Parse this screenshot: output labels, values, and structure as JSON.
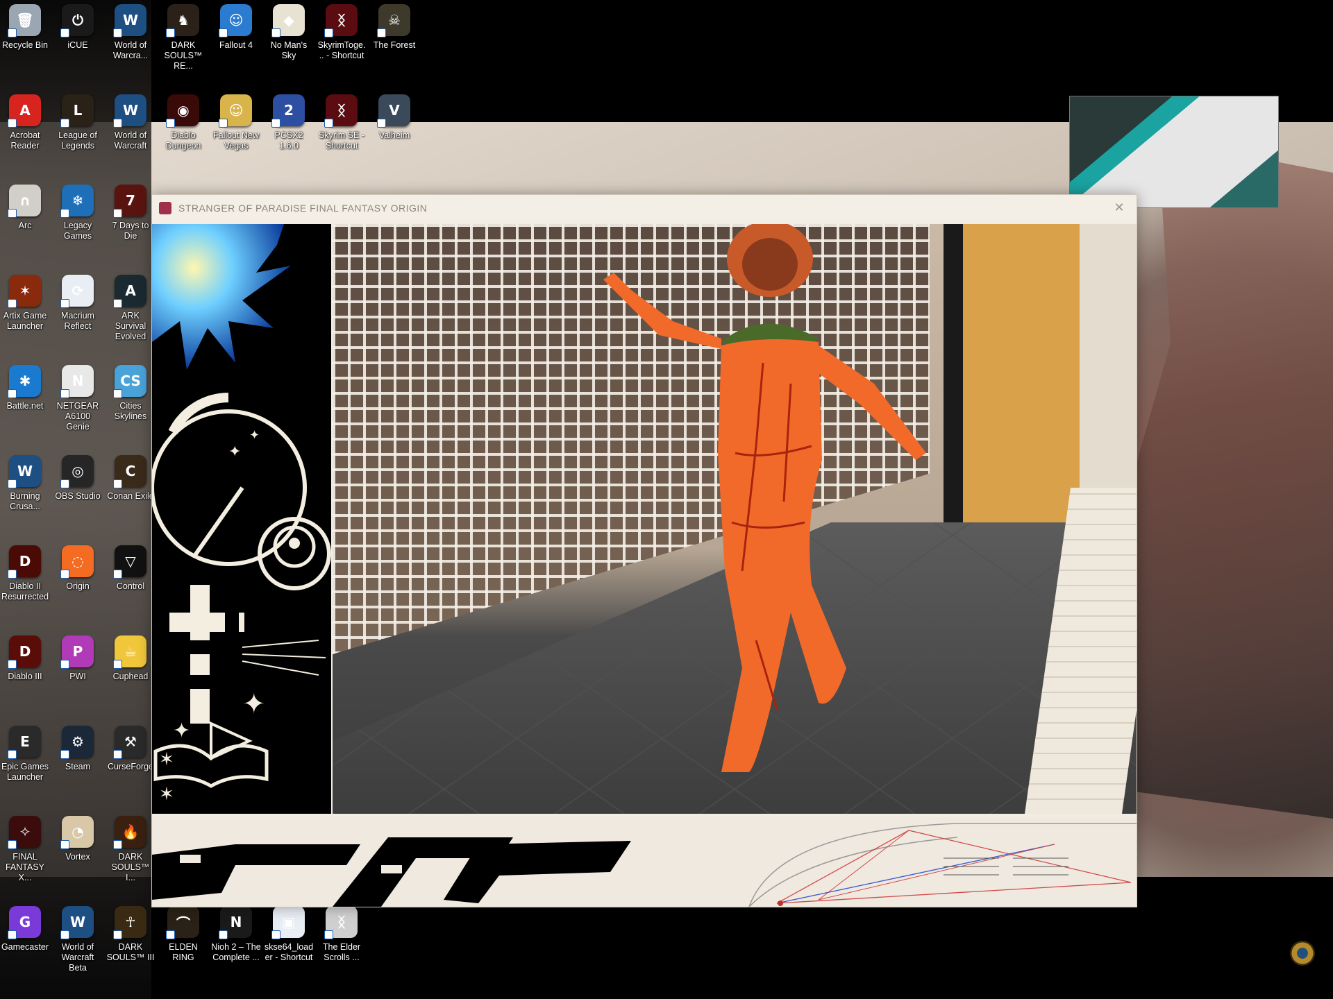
{
  "desktop_icons": [
    {
      "label": "Recycle Bin",
      "icon": "recycle-bin-icon",
      "color": "#9aa6b2",
      "glyph": "🗑"
    },
    {
      "label": "iCUE",
      "icon": "icue-icon",
      "color": "#1a1a1a",
      "glyph": "⏻"
    },
    {
      "label": "World of Warcra...",
      "icon": "world-of-warcraft-icon",
      "color": "#1d4f82",
      "glyph": "W"
    },
    {
      "label": "DARK SOULS™ RE...",
      "icon": "dark-souls-remastered-icon",
      "color": "#2b2118",
      "glyph": "♞"
    },
    {
      "label": "Fallout 4",
      "icon": "fallout-4-icon",
      "color": "#2b7bd0",
      "glyph": "☺"
    },
    {
      "label": "No Man's Sky",
      "icon": "no-mans-sky-icon",
      "color": "#e8e2d2",
      "glyph": "◆"
    },
    {
      "label": "SkyrimToge... - Shortcut",
      "icon": "skyrim-together-icon",
      "color": "#5a0c10",
      "glyph": "ᛝ"
    },
    {
      "label": "The Forest",
      "icon": "the-forest-icon",
      "color": "#3d3a2c",
      "glyph": "☠"
    },
    {
      "label": "Acrobat Reader",
      "icon": "acrobat-reader-icon",
      "color": "#d8241f",
      "glyph": "A"
    },
    {
      "label": "League of Legends",
      "icon": "league-of-legends-icon",
      "color": "#2a2216",
      "glyph": "L"
    },
    {
      "label": "World of Warcraft",
      "icon": "world-of-warcraft-icon-2",
      "color": "#1d4f82",
      "glyph": "W"
    },
    {
      "label": "Diablo Dungeon",
      "icon": "diablo-icon",
      "color": "#3a0a08",
      "glyph": "◉"
    },
    {
      "label": "Fallout New Vegas",
      "icon": "fallout-new-vegas-icon",
      "color": "#d9b44a",
      "glyph": "☺"
    },
    {
      "label": "PCSX2 1.6.0",
      "icon": "pcsx2-icon",
      "color": "#2d4fa3",
      "glyph": "2"
    },
    {
      "label": "Skyrim SE - Shortcut",
      "icon": "skyrim-se-icon",
      "color": "#5a0c10",
      "glyph": "ᛝ"
    },
    {
      "label": "Valheim",
      "icon": "valheim-icon",
      "color": "#3a4a5a",
      "glyph": "V"
    },
    {
      "label": "Arc",
      "icon": "arc-icon",
      "color": "#d2cfc8",
      "glyph": "∩"
    },
    {
      "label": "Legacy Games",
      "icon": "legacy-games-icon",
      "color": "#1f6fb8",
      "glyph": "❄"
    },
    {
      "label": "7 Days to Die",
      "icon": "7-days-to-die-icon",
      "color": "#5a1410",
      "glyph": "7"
    },
    {
      "label": "Artix Game Launcher",
      "icon": "artix-icon",
      "color": "#8a2a0c",
      "glyph": "✶"
    },
    {
      "label": "Macrium Reflect",
      "icon": "macrium-reflect-icon",
      "color": "#e8eef4",
      "glyph": "⟳"
    },
    {
      "label": "ARK Survival Evolved",
      "icon": "ark-icon",
      "color": "#1a2a30",
      "glyph": "A"
    },
    {
      "label": "Battle.net",
      "icon": "battle-net-icon",
      "color": "#1a7ad0",
      "glyph": "✱"
    },
    {
      "label": "NETGEAR A6100 Genie",
      "icon": "netgear-icon",
      "color": "#e8e8e8",
      "glyph": "N"
    },
    {
      "label": "Cities Skylines",
      "icon": "cities-skylines-icon",
      "color": "#4aa3d8",
      "glyph": "CS"
    },
    {
      "label": "Burning Crusa...",
      "icon": "burning-crusade-icon",
      "color": "#1d4f82",
      "glyph": "W"
    },
    {
      "label": "OBS Studio",
      "icon": "obs-studio-icon",
      "color": "#262626",
      "glyph": "◎"
    },
    {
      "label": "Conan Exile",
      "icon": "conan-exiles-icon",
      "color": "#3a2a1a",
      "glyph": "C"
    },
    {
      "label": "Diablo II Resurrected",
      "icon": "diablo-2-icon",
      "color": "#4a0a06",
      "glyph": "D"
    },
    {
      "label": "Origin",
      "icon": "origin-icon",
      "color": "#f36c21",
      "glyph": "◌"
    },
    {
      "label": "Control",
      "icon": "control-icon",
      "color": "#111111",
      "glyph": "▽"
    },
    {
      "label": "Diablo III",
      "icon": "diablo-3-icon",
      "color": "#5a0c08",
      "glyph": "D"
    },
    {
      "label": "PWI",
      "icon": "pwi-icon",
      "color": "#b03ab8",
      "glyph": "P"
    },
    {
      "label": "Cuphead",
      "icon": "cuphead-icon",
      "color": "#f0c63a",
      "glyph": "☕"
    },
    {
      "label": "Epic Games Launcher",
      "icon": "epic-games-icon",
      "color": "#2a2a2a",
      "glyph": "E"
    },
    {
      "label": "Steam",
      "icon": "steam-icon",
      "color": "#1b2838",
      "glyph": "⚙"
    },
    {
      "label": "CurseForge",
      "icon": "curseforge-icon",
      "color": "#2a2a2a",
      "glyph": "⚒"
    },
    {
      "label": "FINAL FANTASY X...",
      "icon": "final-fantasy-xiv-icon",
      "color": "#3a0c0c",
      "glyph": "✧"
    },
    {
      "label": "Vortex",
      "icon": "vortex-icon",
      "color": "#d8c8a8",
      "glyph": "◔"
    },
    {
      "label": "DARK SOULS™ I...",
      "icon": "dark-souls-2-icon",
      "color": "#3a2010",
      "glyph": "🔥"
    },
    {
      "label": "Gamecaster",
      "icon": "gamecaster-icon",
      "color": "#7a3ad8",
      "glyph": "G"
    },
    {
      "label": "World of Warcraft Beta",
      "icon": "wow-beta-icon",
      "color": "#1d4f82",
      "glyph": "W"
    },
    {
      "label": "DARK SOULS™ III",
      "icon": "dark-souls-3-icon",
      "color": "#3a2a14",
      "glyph": "☥"
    },
    {
      "label": "ELDEN RING",
      "icon": "elden-ring-icon",
      "color": "#2a2216",
      "glyph": "⌒"
    },
    {
      "label": "Nioh 2 – The Complete ...",
      "icon": "nioh-2-icon",
      "color": "#1a1a1a",
      "glyph": "N"
    },
    {
      "label": "skse64_loader - Shortcut",
      "icon": "skse64-loader-icon",
      "color": "#e8eef4",
      "glyph": "▣"
    },
    {
      "label": "The Elder Scrolls ...",
      "icon": "elder-scrolls-icon",
      "color": "#cfcfcf",
      "glyph": "ᛝ"
    }
  ],
  "window": {
    "title": "STRANGER OF PARADISE FINAL FANTASY ORIGIN",
    "close_glyph": "✕"
  },
  "colors": {
    "costume": "#f26a2a",
    "accent_teal": "#1aa3a0"
  }
}
